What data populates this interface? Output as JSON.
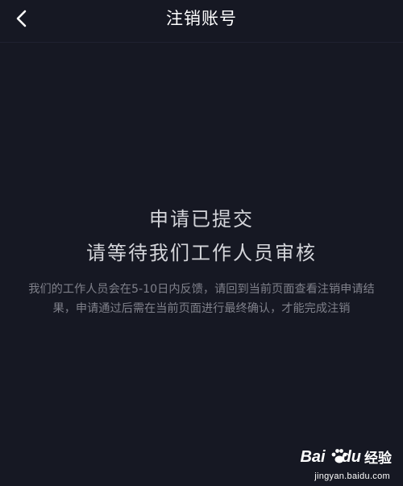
{
  "nav": {
    "title": "注销账号",
    "back_icon": "chevron-left-icon"
  },
  "status": {
    "line1": "申请已提交",
    "line2": "请等待我们工作人员审核",
    "description": "我们的工作人员会在5-10日内反馈，请回到当前页面查看注销申请结果，申请通过后需在当前页面进行最终确认，才能完成注销"
  },
  "watermark": {
    "logo_bai": "Bai",
    "logo_du": "du",
    "logo_jingyan": "经验",
    "url": "jingyan.baidu.com"
  },
  "colors": {
    "background": "#161823",
    "title": "#ffffff",
    "heading": "#d4d5da",
    "description": "#7f808a"
  }
}
